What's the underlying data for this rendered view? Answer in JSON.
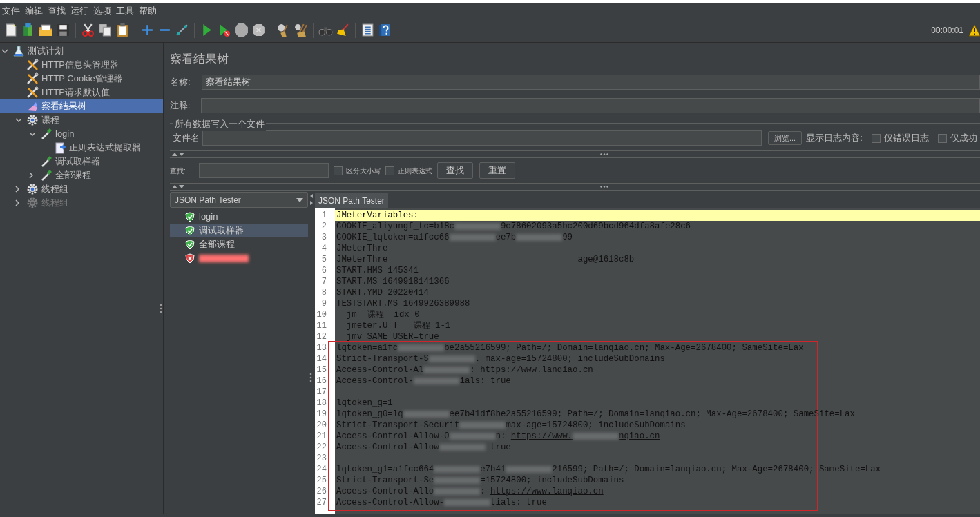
{
  "menu": [
    "文件",
    "编辑",
    "查找",
    "运行",
    "选项",
    "工具",
    "帮助"
  ],
  "toolbar": {
    "timer": "00:00:01"
  },
  "tree": [
    {
      "label": "测试计划",
      "kind": "plan",
      "expanded": true,
      "selected": false,
      "disabled": false,
      "children": [
        {
          "label": "HTTP信息头管理器",
          "kind": "tool",
          "selected": false,
          "disabled": false
        },
        {
          "label": "HTTP Cookie管理器",
          "kind": "tool",
          "selected": false,
          "disabled": false
        },
        {
          "label": "HTTP请求默认值",
          "kind": "tool",
          "selected": false,
          "disabled": false
        },
        {
          "label": "察看结果树",
          "kind": "listener",
          "selected": true,
          "disabled": false
        },
        {
          "label": "课程",
          "kind": "gear",
          "expanded": true,
          "selected": false,
          "disabled": false,
          "children": [
            {
              "label": "login",
              "kind": "sampler",
              "expanded": true,
              "selected": false,
              "disabled": false,
              "children": [
                {
                  "label": "正则表达式提取器",
                  "kind": "extractor",
                  "selected": false,
                  "disabled": false
                }
              ]
            },
            {
              "label": "调试取样器",
              "kind": "sampler",
              "selected": false,
              "disabled": false
            },
            {
              "label": "全部课程",
              "kind": "sampler",
              "expanded": false,
              "selected": false,
              "disabled": false
            }
          ]
        },
        {
          "label": "线程组",
          "kind": "gear",
          "expanded": false,
          "selected": false,
          "disabled": false
        },
        {
          "label": "线程组",
          "kind": "gear",
          "expanded": false,
          "selected": false,
          "disabled": true
        }
      ]
    }
  ],
  "panel": {
    "title": "察看结果树",
    "name_label": "名称:",
    "name_value": "察看结果树",
    "comment_label": "注释:",
    "file_group": {
      "legend": "所有数据写入一个文件",
      "file_label": "文件名",
      "browse_button": "浏览...",
      "log_label": "显示日志内容:",
      "checkboxes": [
        {
          "label": "仅错误日志",
          "checked": false
        },
        {
          "label": "仅成功",
          "checked": false
        }
      ]
    },
    "search": {
      "label": "查找:",
      "checkboxes": [
        {
          "label": "区分大小写",
          "checked": false
        },
        {
          "label": "正则表达式",
          "checked": false
        }
      ],
      "buttons": [
        "查找",
        "重置"
      ]
    }
  },
  "renderer": {
    "selected": "JSON Path Tester"
  },
  "results": [
    {
      "label": "login",
      "kind": "pass",
      "selected": false
    },
    {
      "label": "调试取样器",
      "kind": "pass",
      "selected": true
    },
    {
      "label": "全部课程",
      "kind": "pass",
      "selected": false
    },
    {
      "kind": "fail",
      "selected": false
    }
  ],
  "editor": {
    "tab": "JSON Path Tester",
    "lines": [
      {
        "number": "1",
        "current": true,
        "segments": [
          {
            "kind": "text",
            "text": "JMeterVariables:"
          }
        ]
      },
      {
        "number": "2",
        "current": false,
        "segments": [
          {
            "kind": "text",
            "text": "COOKIE_aliyungf_tc=b18c"
          },
          {
            "kind": "redacted"
          },
          {
            "kind": "text",
            "text": "9c78602093a5bc200d69bcd964dfa8afe28c6"
          }
        ]
      },
      {
        "number": "3",
        "current": false,
        "segments": [
          {
            "kind": "text",
            "text": "COOKIE_lqtoken=a1fcc66"
          },
          {
            "kind": "redacted"
          },
          {
            "kind": "text",
            "text": "ee7b"
          },
          {
            "kind": "redacted"
          },
          {
            "kind": "text",
            "text": "99"
          }
        ]
      },
      {
        "number": "4",
        "current": false,
        "segments": [
          {
            "kind": "text",
            "text": "JMeterThre"
          }
        ]
      },
      {
        "number": "5",
        "current": false,
        "segments": [
          {
            "kind": "text",
            "text": "JMeterThre"
          },
          {
            "kind": "covered"
          },
          {
            "kind": "text",
            "text": "age@1618c8b"
          }
        ]
      },
      {
        "number": "6",
        "current": false,
        "segments": [
          {
            "kind": "text",
            "text": "START.HMS=145341"
          }
        ]
      },
      {
        "number": "7",
        "current": false,
        "segments": [
          {
            "kind": "text",
            "text": "START.MS=1649918141366"
          }
        ]
      },
      {
        "number": "8",
        "current": false,
        "segments": [
          {
            "kind": "text",
            "text": "START.YMD=20220414"
          }
        ]
      },
      {
        "number": "9",
        "current": false,
        "segments": [
          {
            "kind": "text",
            "text": "TESTSTART.MS=1649926389988"
          }
        ]
      },
      {
        "number": "10",
        "current": false,
        "segments": [
          {
            "kind": "text",
            "text": "__jm__课程__idx=0"
          }
        ]
      },
      {
        "number": "11",
        "current": false,
        "segments": [
          {
            "kind": "text",
            "text": "__jmeter.U_T__=课程 1-1"
          }
        ]
      },
      {
        "number": "12",
        "current": false,
        "segments": [
          {
            "kind": "text",
            "text": "__jmv_SAME_USER=true"
          }
        ]
      },
      {
        "number": "13",
        "current": false,
        "segments": [
          {
            "kind": "text",
            "text": "lqtoken=a1fc"
          },
          {
            "kind": "redacted"
          },
          {
            "kind": "text",
            "text": "be2a55216599; Path=/; Domain=lanqiao.cn; Max-Age=2678400; SameSite=Lax"
          }
        ]
      },
      {
        "number": "14",
        "current": false,
        "segments": [
          {
            "kind": "text",
            "text": "Strict-Transport-S"
          },
          {
            "kind": "redacted"
          },
          {
            "kind": "text",
            "text": ". max-age=15724800; includeSubDomains"
          }
        ]
      },
      {
        "number": "15",
        "current": false,
        "segments": [
          {
            "kind": "text",
            "text": "Access-Control-Al"
          },
          {
            "kind": "redacted"
          },
          {
            "kind": "text",
            "text": ": "
          },
          {
            "kind": "link",
            "text": "https://www.lanqiao.cn"
          }
        ]
      },
      {
        "number": "16",
        "current": false,
        "segments": [
          {
            "kind": "text",
            "text": "Access-Control-"
          },
          {
            "kind": "redacted"
          },
          {
            "kind": "text",
            "text": "ials: true"
          }
        ]
      },
      {
        "number": "17",
        "current": false
      },
      {
        "number": "18",
        "current": false,
        "segments": [
          {
            "kind": "text",
            "text": "lqtoken_g=1"
          }
        ]
      },
      {
        "number": "19",
        "current": false,
        "segments": [
          {
            "kind": "text",
            "text": "lqtoken_g0=lq"
          },
          {
            "kind": "redacted"
          },
          {
            "kind": "text",
            "text": "ee7b41df8be2a55216599; Path=/; Domain=lanqiao.cn; Max-Age=2678400; SameSite=Lax"
          }
        ]
      },
      {
        "number": "20",
        "current": false,
        "segments": [
          {
            "kind": "text",
            "text": "Strict-Transport-Securit"
          },
          {
            "kind": "redacted"
          },
          {
            "kind": "text",
            "text": "max-age=15724800; includeSubDomains"
          }
        ]
      },
      {
        "number": "21",
        "current": false,
        "segments": [
          {
            "kind": "text",
            "text": "Access-Control-Allow-O"
          },
          {
            "kind": "redacted"
          },
          {
            "kind": "text",
            "text": "n: "
          },
          {
            "kind": "link",
            "text": "https://www."
          },
          {
            "kind": "redacted"
          },
          {
            "kind": "link",
            "text": "nqiao.cn"
          }
        ]
      },
      {
        "number": "22",
        "current": false,
        "segments": [
          {
            "kind": "text",
            "text": "Access-Control-Allow"
          },
          {
            "kind": "redacted"
          },
          {
            "kind": "text",
            "text": " true"
          }
        ]
      },
      {
        "number": "23",
        "current": false
      },
      {
        "number": "24",
        "current": false,
        "segments": [
          {
            "kind": "text",
            "text": "lqtoken_g1=a1fcc664"
          },
          {
            "kind": "redacted"
          },
          {
            "kind": "text",
            "text": "e7b41"
          },
          {
            "kind": "redacted"
          },
          {
            "kind": "text",
            "text": "216599; Path=/; Domain=lanqiao.cn; Max-Age=2678400; SameSite=Lax"
          }
        ]
      },
      {
        "number": "25",
        "current": false,
        "segments": [
          {
            "kind": "text",
            "text": "Strict-Transport-Se"
          },
          {
            "kind": "redacted"
          },
          {
            "kind": "text",
            "text": "=15724800; includeSubDomains"
          }
        ]
      },
      {
        "number": "26",
        "current": false,
        "segments": [
          {
            "kind": "text",
            "text": "Access-Control-Allo"
          },
          {
            "kind": "redacted"
          },
          {
            "kind": "text",
            "text": ": "
          },
          {
            "kind": "link",
            "text": "https://www.lanqiao.cn"
          }
        ]
      },
      {
        "number": "27",
        "current": false,
        "segments": [
          {
            "kind": "text",
            "text": "Access-Control-Allow-"
          },
          {
            "kind": "redacted"
          },
          {
            "kind": "text",
            "text": "tials: true"
          }
        ]
      }
    ]
  },
  "annotation_frame": {
    "kind": "rect"
  }
}
